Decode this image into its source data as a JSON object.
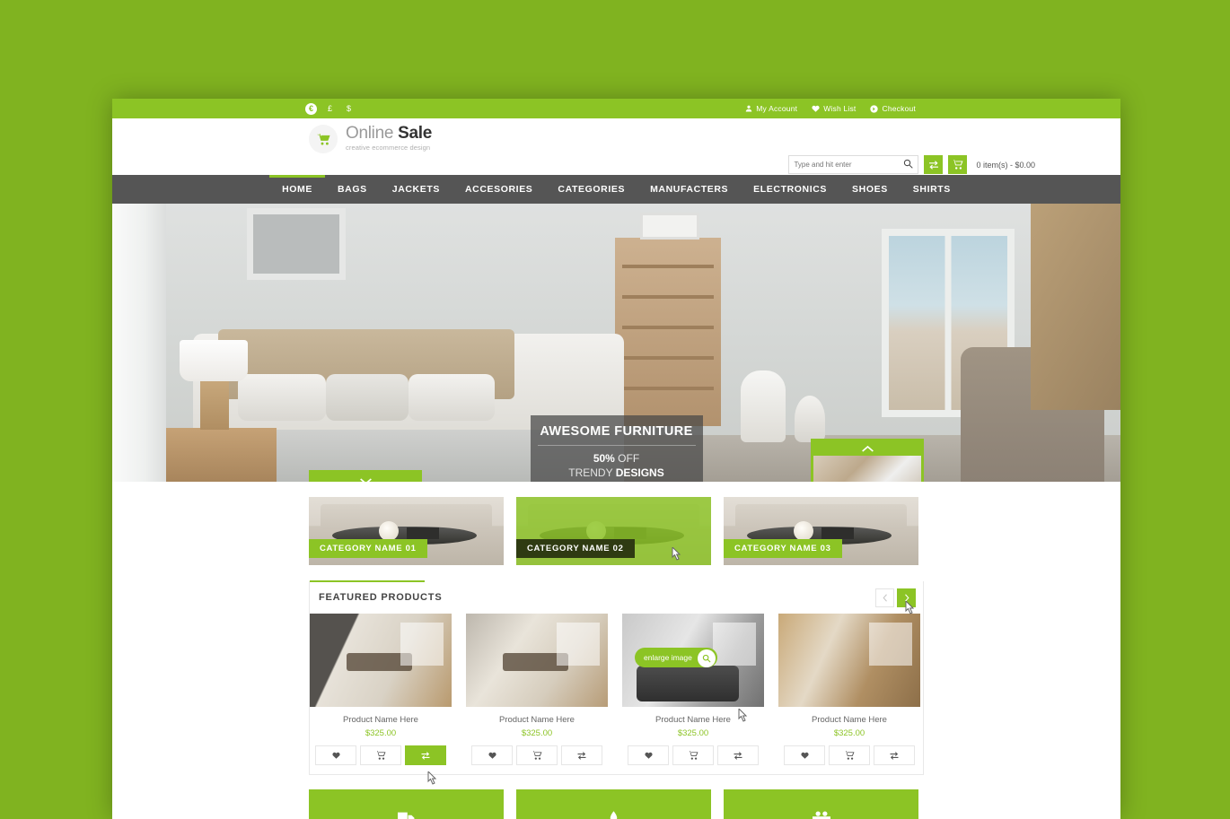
{
  "theme": {
    "bg_green": "#80b320",
    "accent_green": "#8cc425",
    "nav_dark": "#555555"
  },
  "topbar": {
    "currencies": [
      {
        "symbol": "€",
        "name": "euro",
        "active": true
      },
      {
        "symbol": "£",
        "name": "pound",
        "active": false
      },
      {
        "symbol": "$",
        "name": "dollar",
        "active": false
      }
    ],
    "links": [
      {
        "label": "My Account",
        "icon": "user-icon"
      },
      {
        "label": "Wish List",
        "icon": "heart-icon"
      },
      {
        "label": "Checkout",
        "icon": "checkout-icon"
      }
    ]
  },
  "header": {
    "logo_title_light": "Online ",
    "logo_title_bold": "Sale",
    "logo_subtitle": "creative ecommerce design",
    "logo_icon": "cart-icon",
    "search": {
      "value": "",
      "placeholder": "Type and hit enter",
      "icon": "search-icon"
    },
    "compare_button_icon": "compare-icon",
    "cart_button_icon": "cart-icon",
    "cart_total": "0 item(s) - $0.00"
  },
  "nav": {
    "items": [
      {
        "label": "HOME",
        "active": true
      },
      {
        "label": "BAGS",
        "active": false
      },
      {
        "label": "JACKETS",
        "active": false
      },
      {
        "label": "ACCESORIES",
        "active": false
      },
      {
        "label": "CATEGORIES",
        "active": false
      },
      {
        "label": "MANUFACTERS",
        "active": false
      },
      {
        "label": "ELECTRONICS",
        "active": false
      },
      {
        "label": "SHOES",
        "active": false
      },
      {
        "label": "SHIRTS",
        "active": false
      }
    ]
  },
  "hero": {
    "caption_title": "AWESOME FURNITURE",
    "caption_discount": "50%",
    "caption_discount_suffix": " OFF",
    "caption_line2_prefix": "TRENDY ",
    "caption_line2_bold": "DESIGNS",
    "prev_icon": "chevron-down-icon",
    "next_icon": "chevron-up-icon"
  },
  "categories": [
    {
      "label": "CATEGORY NAME 01",
      "hovered": false
    },
    {
      "label": "CATEGORY NAME 02",
      "hovered": true
    },
    {
      "label": "CATEGORY NAME 03",
      "hovered": false
    }
  ],
  "featured": {
    "title": "FEATURED PRODUCTS",
    "prev_icon": "chevron-left-icon",
    "next_icon": "chevron-right-icon",
    "tooltip_label": "enlarge image",
    "tooltip_icon": "magnifier-icon",
    "products": [
      {
        "name": "Product Name Here",
        "price": "$325.00",
        "actions": [
          {
            "icon": "heart-icon",
            "active": false
          },
          {
            "icon": "cart-icon",
            "active": false
          },
          {
            "icon": "compare-icon",
            "active": true
          }
        ]
      },
      {
        "name": "Product Name Here",
        "price": "$325.00",
        "actions": [
          {
            "icon": "heart-icon",
            "active": false
          },
          {
            "icon": "cart-icon",
            "active": false
          },
          {
            "icon": "compare-icon",
            "active": false
          }
        ]
      },
      {
        "name": "Product Name Here",
        "price": "$325.00",
        "actions": [
          {
            "icon": "heart-icon",
            "active": false
          },
          {
            "icon": "cart-icon",
            "active": false
          },
          {
            "icon": "compare-icon",
            "active": false
          }
        ]
      },
      {
        "name": "Product Name Here",
        "price": "$325.00",
        "actions": [
          {
            "icon": "heart-icon",
            "active": false
          },
          {
            "icon": "cart-icon",
            "active": false
          },
          {
            "icon": "compare-icon",
            "active": false
          }
        ]
      }
    ]
  },
  "infobars": [
    {
      "icon": "truck-icon"
    },
    {
      "icon": "leaf-icon"
    },
    {
      "icon": "gift-icon"
    }
  ]
}
